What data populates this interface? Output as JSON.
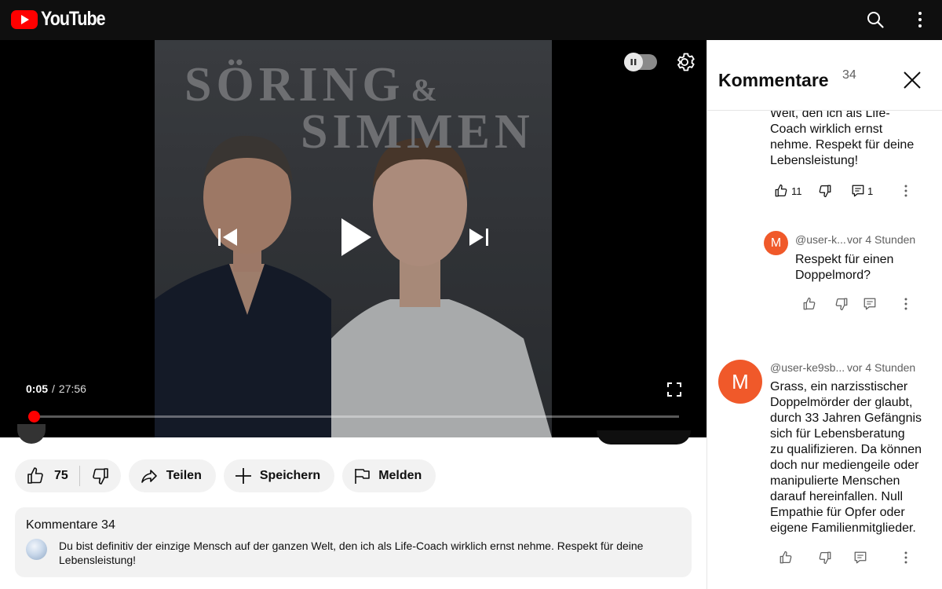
{
  "app": {
    "logo_text": "YouTube"
  },
  "header": {
    "search_icon": "search-icon",
    "menu_icon": "more-vertical-icon"
  },
  "video": {
    "thumbnail_title_line1": "SÖRING",
    "thumbnail_title_amp": "&",
    "thumbnail_title_line2": "SIMMEN",
    "current_time": "0:05",
    "separator": "/",
    "duration": "27:56",
    "progress_fraction": 0.003,
    "autoplay_icon": "pause-icon"
  },
  "actions": {
    "like_count": "75",
    "share_label": "Teilen",
    "save_label": "Speichern",
    "report_label": "Melden"
  },
  "comments_preview": {
    "title": "Kommentare 34",
    "text": "Du bist definitiv der einzige Mensch auf der ganzen Welt, den ich als Life-Coach wirklich ernst nehme. Respekt für deine Lebensleistung!"
  },
  "panel": {
    "title": "Kommentare",
    "count": "34",
    "comments": [
      {
        "text_lines": [
          "Welt, den ich als Life-",
          "Coach wirklich ernst",
          "nehme. Respekt für deine",
          "Lebensleistung!"
        ],
        "likes": "11",
        "replies": "1"
      },
      {
        "avatar_letter": "M",
        "author": "@user-k...",
        "time": "vor 4 Stunden",
        "text_lines": [
          "Respekt für einen",
          "Doppelmord?"
        ]
      },
      {
        "avatar_letter": "M",
        "author": "@user-ke9sb...",
        "time": "vor 4 Stunden",
        "text_lines": [
          "Grass, ein narzisstischer",
          "Doppelmörder der glaubt,",
          "durch 33 Jahren Gefängnis",
          "sich für Lebensberatung",
          "zu qualifizieren. Da können",
          "doch nur mediengeile oder",
          "manipulierte Menschen",
          "darauf hereinfallen. Null",
          "Empathie für Opfer oder",
          "eigene Familienmitglieder."
        ]
      }
    ]
  },
  "colors": {
    "brand": "#ff0000",
    "avatar": "#f0592a",
    "topbar": "#0f0f0f"
  }
}
